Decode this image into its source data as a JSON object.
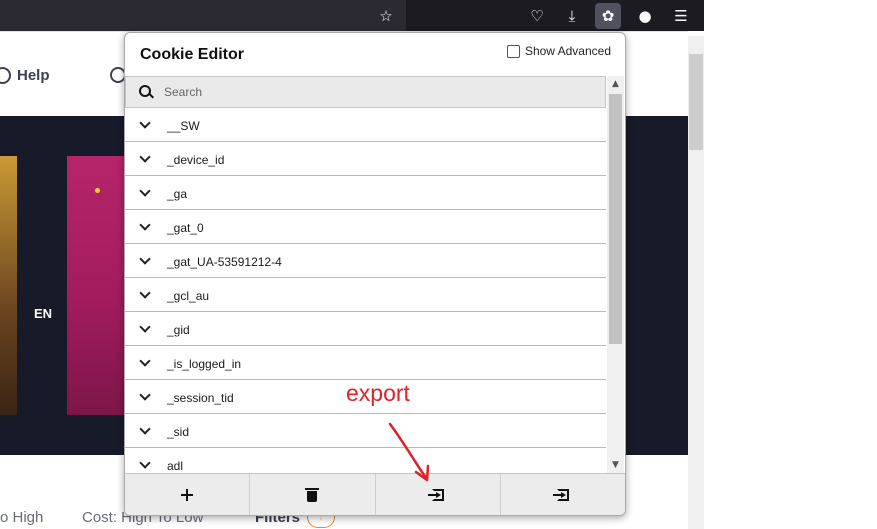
{
  "browser": {
    "toolbar_icons": [
      "star-icon",
      "pocket-icon",
      "download-icon",
      "cookie-editor-icon",
      "extension-icon",
      "menu-icon"
    ]
  },
  "page": {
    "help_label": "Help",
    "banner_text": "EN",
    "sort_options": [
      "o High",
      "Cost: High To Low"
    ],
    "filters_label": "Filters"
  },
  "popup": {
    "title": "Cookie Editor",
    "show_advanced_label": "Show Advanced",
    "search_placeholder": "Search",
    "cookies": [
      "__SW",
      "_device_id",
      "_ga",
      "_gat_0",
      "_gat_UA-53591212-4",
      "_gcl_au",
      "_gid",
      "_is_logged_in",
      "_session_tid",
      "_sid",
      "adl"
    ],
    "footer_buttons": [
      "add-icon",
      "delete-icon",
      "import-icon",
      "export-icon"
    ]
  },
  "annotation": {
    "text": "export",
    "color": "#e0202a"
  }
}
